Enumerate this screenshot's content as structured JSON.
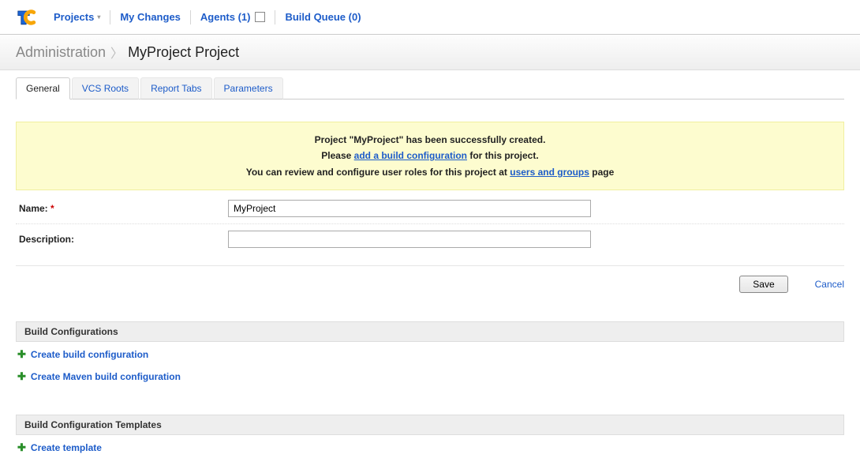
{
  "nav": {
    "projects": "Projects",
    "my_changes": "My Changes",
    "agents": "Agents (1)",
    "build_queue": "Build Queue (0)"
  },
  "breadcrumb": {
    "root": "Administration",
    "current": "MyProject Project"
  },
  "tabs": {
    "general": "General",
    "vcs_roots": "VCS Roots",
    "report_tabs": "Report Tabs",
    "parameters": "Parameters"
  },
  "notice": {
    "line1_prefix": "Project \"MyProject\" has been successfully created.",
    "line2_prefix": "Please ",
    "line2_link": "add a build configuration",
    "line2_suffix": " for this project.",
    "line3_prefix": "You can review and configure user roles for this project at ",
    "line3_link": "users and groups",
    "line3_suffix": " page"
  },
  "form": {
    "name_label": "Name:",
    "name_value": "MyProject",
    "description_label": "Description:",
    "description_value": ""
  },
  "actions": {
    "save": "Save",
    "cancel": "Cancel"
  },
  "sections": {
    "build_configs": "Build Configurations",
    "create_build_config": "Create build configuration",
    "create_maven_build_config": "Create Maven build configuration",
    "build_templates": "Build Configuration Templates",
    "create_template": "Create template"
  }
}
